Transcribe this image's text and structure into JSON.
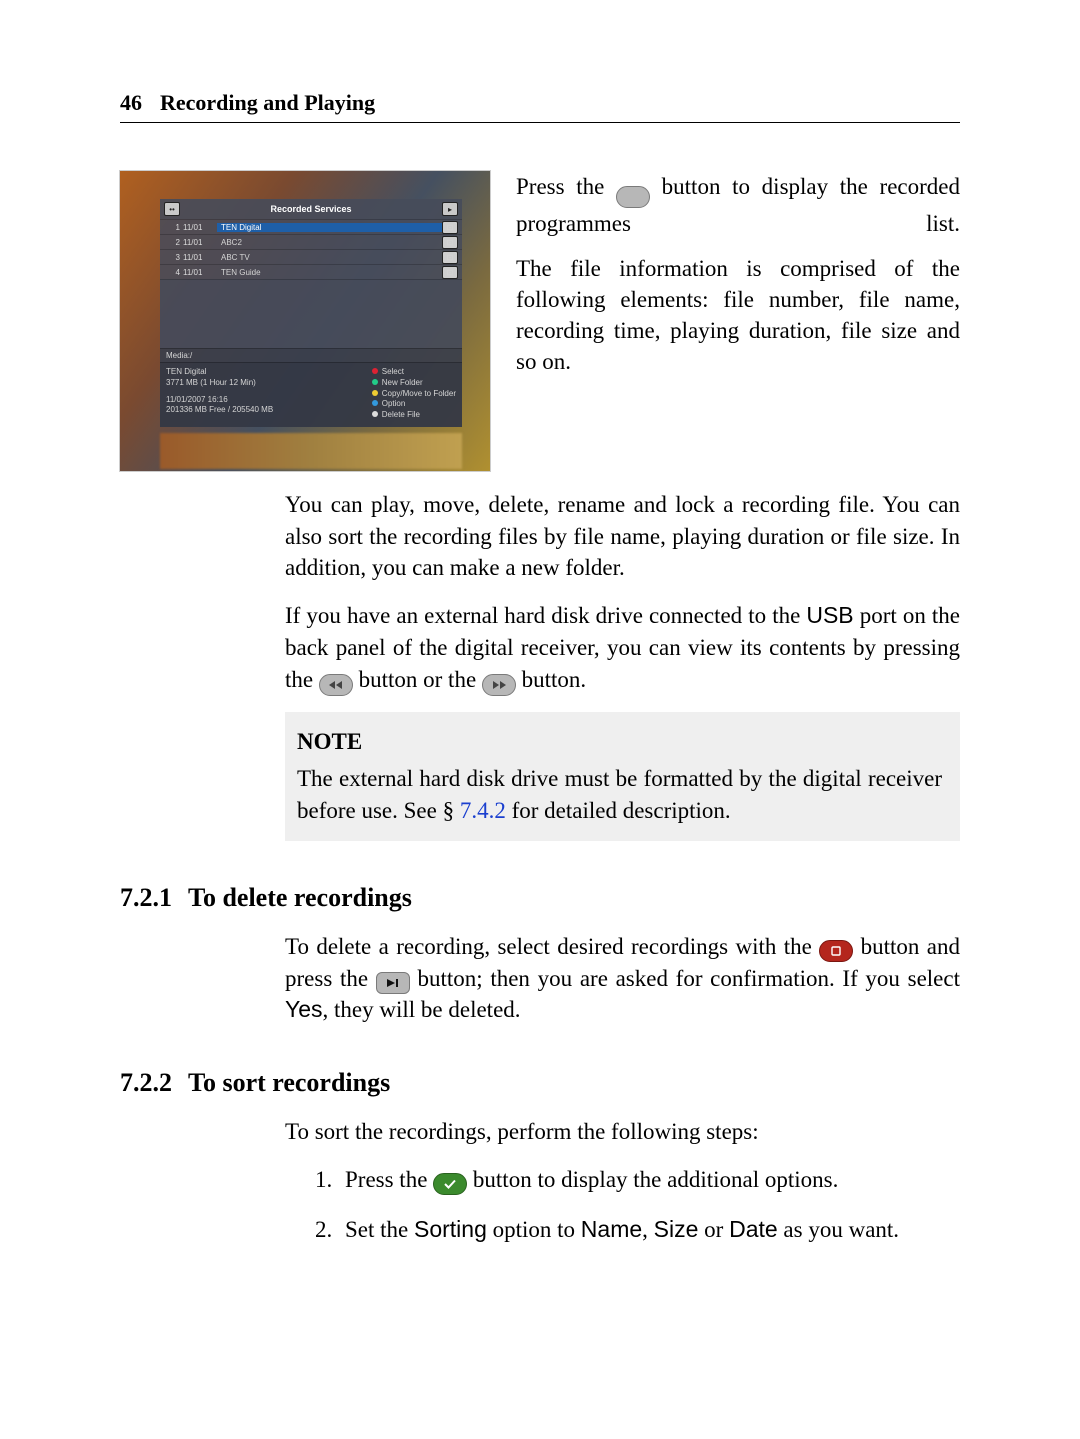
{
  "header": {
    "page_number": "46",
    "chapter_title": "Recording and Playing"
  },
  "intro_right": {
    "p1a": "Press the ",
    "p1b": " button to display the recorded programmes list.",
    "p2": "The file information is comprised of the following elements: file number, file name, recording time, playing duration, file size and so on."
  },
  "body": {
    "p3": "You can play, move, delete, rename and lock a recording file. You can also sort the recording files by file name, playing duration or file size. In addition, you can make a new folder.",
    "p4a": "If you have an external hard disk drive connected to the ",
    "p4_usb": "USB",
    "p4b": " port on the back panel of the digital receiver, you can view its contents by pressing the ",
    "p4c": " button or the ",
    "p4d": " button."
  },
  "note": {
    "title": "NOTE",
    "text_a": "The external hard disk drive must be formatted by the digital receiver before use. See § ",
    "link": "7.4.2",
    "text_b": " for detailed description."
  },
  "sec721": {
    "num": "7.2.1",
    "title": "To delete recordings",
    "p_a": "To delete a recording, select desired recordings with the ",
    "p_b": " button and press the ",
    "p_c": " button; then you are asked for confirmation. If you select ",
    "yes": "Yes",
    "p_d": ", they will be deleted."
  },
  "sec722": {
    "num": "7.2.2",
    "title": "To sort recordings",
    "intro": "To sort the recordings, perform the following steps:",
    "steps": {
      "s1a": "Press the ",
      "s1b": " button to display the additional options.",
      "s2a": "Set the ",
      "s2_sorting": "Sorting",
      "s2b": " option to ",
      "s2_name": "Name",
      "s2c": ", ",
      "s2_size": "Size",
      "s2d": " or ",
      "s2_date": "Date",
      "s2e": " as you want."
    }
  },
  "osd": {
    "title": "Recorded Services",
    "left_chip": "••",
    "right_chip": "▸",
    "rows": [
      {
        "num": "1",
        "date": "11/01",
        "name": "TEN Digital"
      },
      {
        "num": "2",
        "date": "11/01",
        "name": "ABC2"
      },
      {
        "num": "3",
        "date": "11/01",
        "name": "ABC TV"
      },
      {
        "num": "4",
        "date": "11/01",
        "name": "TEN Guide"
      }
    ],
    "media_path": "Media:/",
    "footer_left": {
      "channel": "TEN Digital",
      "size_duration": "3771 MB  (1 Hour 12 Min)",
      "datetime": "11/01/2007 16:16",
      "free": "201336 MB Free / 205540 MB"
    },
    "footer_right": {
      "select": "Select",
      "new_folder": "New Folder",
      "copy_move": "Copy/Move to Folder",
      "option": "Option",
      "delete": "Delete File"
    }
  }
}
